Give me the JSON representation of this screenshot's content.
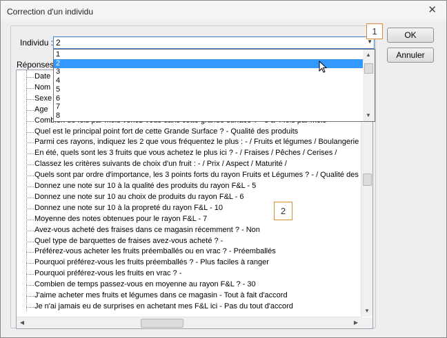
{
  "window": {
    "title": "Correction d'un individu"
  },
  "individu": {
    "label": "Individu :",
    "value": "2"
  },
  "reponses": {
    "label": "Réponses :"
  },
  "buttons": {
    "ok": "OK",
    "cancel": "Annuler"
  },
  "dropdown": {
    "options": [
      "1",
      "2",
      "3",
      "4",
      "5",
      "6",
      "7",
      "8"
    ],
    "selected": "2"
  },
  "tree_rows": [
    "Date",
    "Nom",
    "Sexe",
    "Age",
    "Combien de fois par mois venez-vous dans cette grande surface ? - 3 à 4 fois par mois",
    "Quel est le principal point fort de cette Grande Surface ? - Qualité des produits",
    "Parmi ces rayons, indiquez les 2 que vous fréquentez le plus : - / Fruits et légumes / Boulangerie /",
    "En été, quels sont les 3 fruits que vous achetez le plus ici ? - / Fraises / Pêches / Cerises /",
    "Classez les critères suivants de choix d'un fruit : - / Prix / Aspect / Maturité /",
    "Quels sont par ordre d'importance, les 3 points forts du rayon Fruits et Légumes ? - / Qualité des prod",
    "Donnez une note sur 10 à la qualité des produits du rayon F&L - 5",
    "Donnez une note sur 10 au choix de produits du rayon F&L - 6",
    "Donnez une note sur 10 à la propreté du rayon F&L - 10",
    "Moyenne des notes obtenues pour le rayon F&L -        7",
    "Avez-vous acheté des fraises dans ce magasin récemment ? - Non",
    "Quel type de barquettes de fraises avez-vous acheté ? -",
    "Préférez-vous acheter les fruits préemballés ou en vrac ? - Préemballés",
    "Pourquoi préférez-vous les fruits préemballés ? - Plus faciles à ranger",
    "Pourquoi préférez-vous les fruits en vrac ? -",
    "Combien de temps passez-vous en moyenne au rayon F&L ? - 30",
    "J'aime acheter mes fruits et légumes dans ce magasin - Tout à fait d'accord",
    "Je n'ai jamais eu de surprises en achetant mes F&L ici - Pas du tout d'accord"
  ],
  "badges": {
    "one": "1",
    "two": "2"
  },
  "icons": {
    "close": "close-icon",
    "arrow": "chevron-down-icon",
    "cursor": "mouse-pointer-icon"
  }
}
